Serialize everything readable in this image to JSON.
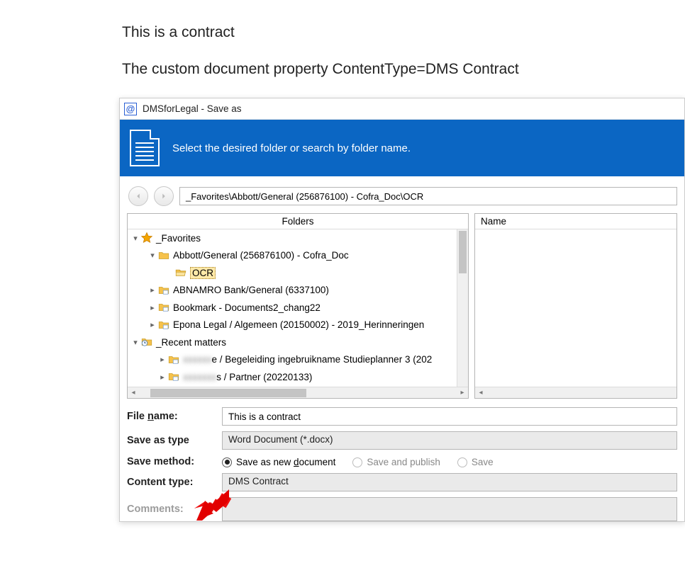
{
  "heading1": "This is a contract",
  "heading2": "The custom document property ContentType=DMS Contract",
  "window": {
    "title": "DMSforLegal - Save as",
    "banner": "Select the desired folder or search by folder name.",
    "path": "_Favorites\\Abbott/General (256876100) - Cofra_Doc\\OCR",
    "folders_header": "Folders",
    "name_header": "Name"
  },
  "tree": {
    "favorites": "_Favorites",
    "abbott": "Abbott/General (256876100) - Cofra_Doc",
    "ocr": "OCR",
    "abnamro": "ABNAMRO Bank/General (6337100)",
    "bookmark": "Bookmark - Documents2_chang22",
    "epona": "Epona Legal / Algemeen (20150002) - 2019_Herinneringen",
    "recent": "_Recent matters",
    "recent1_blur": "xxxxxx",
    "recent1_rest": "e / Begeleiding ingebruikname Studieplanner 3 (202",
    "recent2_blur": "xxxxxxx",
    "recent2_rest": "s / Partner (20220133)"
  },
  "form": {
    "filename_label": "File name:",
    "filename_u": "n",
    "filename_value": "This is a contract",
    "saveas_label": "Save as type",
    "saveas_value": "Word Document (*.docx)",
    "savemethod_label": "Save method:",
    "opt1": "Save as new document",
    "opt1_u": "d",
    "opt2": "Save and publish",
    "opt3": "Save",
    "contenttype_label": "Content type:",
    "contenttype_value": "DMS Contract",
    "comments_label": "Comments:"
  }
}
